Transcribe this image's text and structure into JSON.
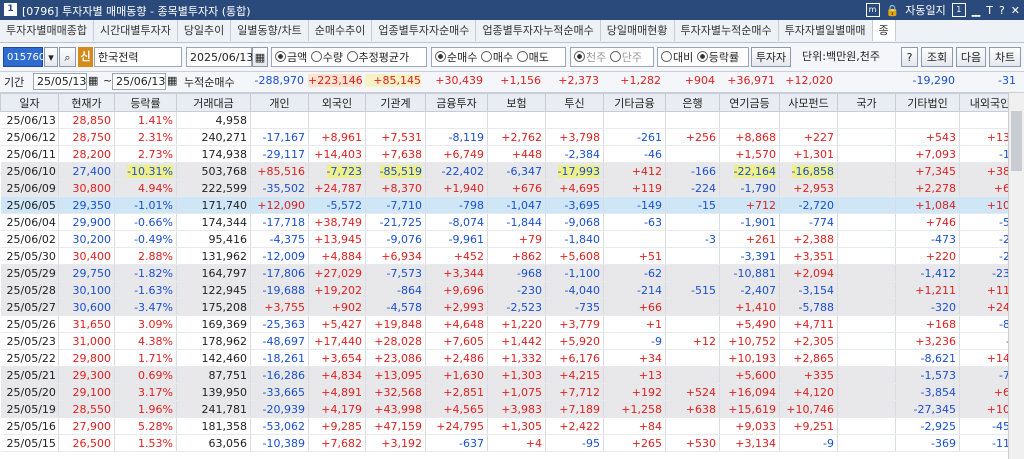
{
  "window": {
    "code": "[0796]",
    "title": "투자자별 매매동향 - 종목별투자자 (통합)",
    "auto_lock": "자동일지",
    "icons": [
      "m-icon",
      "lock-icon",
      "copy-icon",
      "minimize-icon",
      "font-icon",
      "help-icon",
      "close-icon"
    ]
  },
  "tabs": [
    "투자자별매매종합",
    "시간대별투자자",
    "당일추이",
    "일별동향/차트",
    "순매수추이",
    "업종별투자자순매수",
    "업종별투자자누적순매수",
    "당일매매현황",
    "투자자별누적순매수",
    "투자자별일별매매",
    "종"
  ],
  "toolbar": {
    "stock_code": "015760",
    "badge": "신",
    "stock_name": "한국전력",
    "date": "2025/06/13",
    "radio_amount": [
      "금액",
      "수량",
      "추정평균가"
    ],
    "radio_trade": [
      "순매수",
      "매수",
      "매도"
    ],
    "radio_unit": [
      "천주",
      "단주"
    ],
    "radio_compare": [
      "대비",
      "등락률"
    ],
    "investor_btn": "투자자",
    "unit_label": "단위:백만원,천주",
    "help_btn": "?",
    "query_btn": "조회",
    "next_btn": "다음",
    "chart_btn": "차트"
  },
  "filter": {
    "period_label": "기간",
    "from": "25/05/13",
    "to": "25/06/13",
    "cum_label": "누적순매수",
    "cum_values": [
      "-288,970",
      "+223,146",
      "+85,145",
      "+30,439",
      "+1,156",
      "+2,373",
      "+1,282",
      "+904",
      "+36,971",
      "+12,020",
      "",
      "-19,290",
      "-31"
    ]
  },
  "columns": [
    "일자",
    "현재가",
    "등락률",
    "거래대금",
    "개인",
    "외국인",
    "기관계",
    "금융투자",
    "보험",
    "투신",
    "기타금융",
    "은행",
    "연기금등",
    "사모펀드",
    "국가",
    "기타법인",
    "내외국인"
  ],
  "rows": [
    [
      "25/06/13",
      "28,850",
      "1.41%",
      "4,958",
      "",
      "",
      "",
      "",
      "",
      "",
      "",
      "",
      "",
      "",
      "",
      "",
      ""
    ],
    [
      "25/06/12",
      "28,750",
      "2.31%",
      "240,271",
      "-17,167",
      "+8,961",
      "+7,531",
      "-8,119",
      "+2,762",
      "+3,798",
      "-261",
      "+256",
      "+8,868",
      "+227",
      "",
      "+543",
      "+133"
    ],
    [
      "25/06/11",
      "28,200",
      "2.73%",
      "174,938",
      "-29,117",
      "+14,403",
      "+7,638",
      "+6,749",
      "+448",
      "-2,384",
      "-46",
      "",
      "+1,570",
      "+1,301",
      "",
      "+7,093",
      "-18"
    ],
    [
      "25/06/10",
      "27,400",
      "-10.31%",
      "503,768",
      "+85,516",
      "-7,723",
      "-85,519",
      "-22,402",
      "-6,347",
      "-17,993",
      "+412",
      "-166",
      "-22,164",
      "-16,858",
      "",
      "+7,345",
      "+380"
    ],
    [
      "25/06/09",
      "30,800",
      "4.94%",
      "222,599",
      "-35,502",
      "+24,787",
      "+8,370",
      "+1,940",
      "+676",
      "+4,695",
      "+119",
      "-224",
      "-1,790",
      "+2,953",
      "",
      "+2,278",
      "+67"
    ],
    [
      "25/06/05",
      "29,350",
      "-1.01%",
      "171,740",
      "+12,090",
      "-5,572",
      "-7,710",
      "-798",
      "-1,047",
      "-3,695",
      "-149",
      "-15",
      "+712",
      "-2,720",
      "",
      "+1,084",
      "+109"
    ],
    [
      "25/06/04",
      "29,900",
      "-0.66%",
      "174,344",
      "-17,718",
      "+38,749",
      "-21,725",
      "-8,074",
      "-1,844",
      "-9,068",
      "-63",
      "",
      "-1,901",
      "-774",
      "",
      "+746",
      "-52"
    ],
    [
      "25/06/02",
      "30,200",
      "-0.49%",
      "95,416",
      "-4,375",
      "+13,945",
      "-9,076",
      "-9,961",
      "+79",
      "-1,840",
      "",
      "-3",
      "+261",
      "+2,388",
      "",
      "-473",
      "-20"
    ],
    [
      "25/05/30",
      "30,400",
      "2.88%",
      "131,962",
      "-12,009",
      "+4,884",
      "+6,934",
      "+452",
      "+862",
      "+5,608",
      "+51",
      "",
      "-3,391",
      "+3,351",
      "",
      "+220",
      "-29"
    ],
    [
      "25/05/29",
      "29,750",
      "-1.82%",
      "164,797",
      "-17,806",
      "+27,029",
      "-7,573",
      "+3,344",
      "-968",
      "-1,100",
      "-62",
      "",
      "-10,881",
      "+2,094",
      "",
      "-1,412",
      "-238"
    ],
    [
      "25/05/28",
      "30,100",
      "-1.63%",
      "122,945",
      "-19,688",
      "+19,202",
      "-864",
      "+9,696",
      "-230",
      "-4,040",
      "-214",
      "-515",
      "-2,407",
      "-3,154",
      "",
      "+1,211",
      "+119"
    ],
    [
      "25/05/27",
      "30,600",
      "-3.47%",
      "175,208",
      "+3,755",
      "+902",
      "-4,578",
      "+2,993",
      "-2,523",
      "-735",
      "+66",
      "",
      "+1,410",
      "-5,788",
      "",
      "-320",
      "+241"
    ],
    [
      "25/05/26",
      "31,650",
      "3.09%",
      "169,369",
      "-25,363",
      "+5,427",
      "+19,848",
      "+4,648",
      "+1,220",
      "+3,779",
      "+1",
      "",
      "+5,490",
      "+4,711",
      "",
      "+168",
      "-80"
    ],
    [
      "25/05/23",
      "31,000",
      "4.38%",
      "178,962",
      "-48,697",
      "+17,440",
      "+28,028",
      "+7,605",
      "+1,442",
      "+5,920",
      "-9",
      "+12",
      "+10,752",
      "+2,305",
      "",
      "+3,236",
      "-8"
    ],
    [
      "25/05/22",
      "29,800",
      "1.71%",
      "142,460",
      "-18,261",
      "+3,654",
      "+23,086",
      "+2,486",
      "+1,332",
      "+6,176",
      "+34",
      "",
      "+10,193",
      "+2,865",
      "",
      "-8,621",
      "+142"
    ],
    [
      "25/05/21",
      "29,300",
      "0.69%",
      "87,751",
      "-16,286",
      "+4,834",
      "+13,095",
      "+1,630",
      "+1,303",
      "+4,215",
      "+13",
      "",
      "+5,600",
      "+335",
      "",
      "-1,573",
      "-70"
    ],
    [
      "25/05/20",
      "29,100",
      "3.17%",
      "139,950",
      "-33,665",
      "+4,891",
      "+32,568",
      "+2,851",
      "+1,075",
      "+7,712",
      "+192",
      "+524",
      "+16,094",
      "+4,120",
      "",
      "-3,854",
      "+60"
    ],
    [
      "25/05/19",
      "28,550",
      "1.96%",
      "241,781",
      "-20,939",
      "+4,179",
      "+43,998",
      "+4,565",
      "+3,983",
      "+7,189",
      "+1,258",
      "+638",
      "+15,619",
      "+10,746",
      "",
      "-27,345",
      "+108"
    ],
    [
      "25/05/16",
      "27,900",
      "5.28%",
      "181,358",
      "-53,062",
      "+9,285",
      "+47,159",
      "+24,795",
      "+1,305",
      "+2,422",
      "+84",
      "",
      "+9,033",
      "+9,251",
      "",
      "-2,925",
      "-457"
    ],
    [
      "25/05/15",
      "26,500",
      "1.53%",
      "63,056",
      "-10,389",
      "+7,682",
      "+3,192",
      "-637",
      "+4",
      "-95",
      "+265",
      "+530",
      "+3,134",
      "-9",
      "",
      "-369",
      "-116"
    ]
  ],
  "colors": {
    "positive": "#e02020",
    "negative": "#1a4fd0",
    "highlight": "#f0f08a",
    "selected_row": "#cfe6f6",
    "grey_row": "#e8e8ea",
    "title_bar": "#2a4a7c"
  }
}
